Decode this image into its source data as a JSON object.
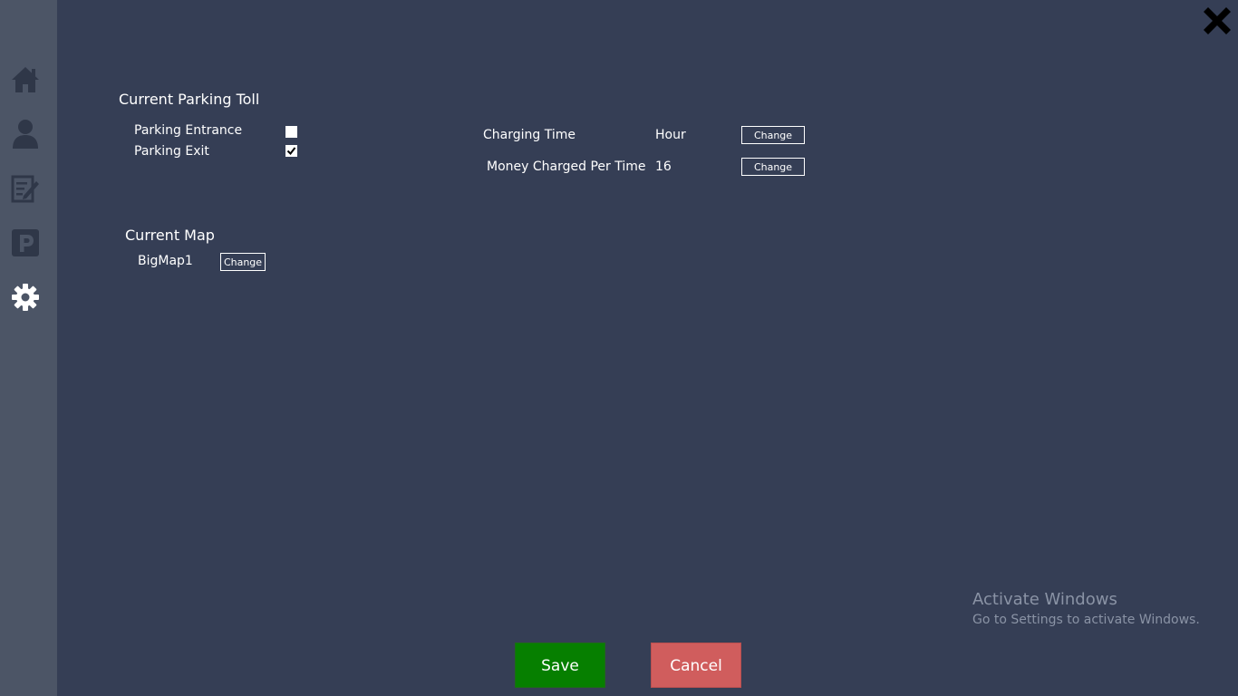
{
  "sidebar": {
    "items": [
      {
        "icon": "home-icon"
      },
      {
        "icon": "user-icon"
      },
      {
        "icon": "edit-icon"
      },
      {
        "icon": "parking-icon",
        "letter": "P"
      },
      {
        "icon": "gear-icon",
        "active": true
      }
    ]
  },
  "toll": {
    "title": "Current Parking Toll",
    "entrance_label": "Parking Entrance",
    "entrance_checked": false,
    "exit_label": "Parking Exit",
    "exit_checked": true
  },
  "charging": {
    "time_label": "Charging Time",
    "time_value": "Hour",
    "time_change": "Change",
    "money_label": "Money Charged Per Time",
    "money_value": "16",
    "money_change": "Change"
  },
  "map": {
    "title": "Current Map",
    "value": "BigMap1",
    "change": "Change"
  },
  "actions": {
    "save": "Save",
    "cancel": "Cancel"
  },
  "watermark": {
    "title": "Activate Windows",
    "subtitle": "Go to Settings to activate Windows."
  },
  "colors": {
    "background": "#353e55",
    "sidebar": "#4c5566",
    "icon_inactive": "#2f3748",
    "icon_active": "#ffffff",
    "save": "#067f00",
    "cancel": "#d05d5d"
  }
}
